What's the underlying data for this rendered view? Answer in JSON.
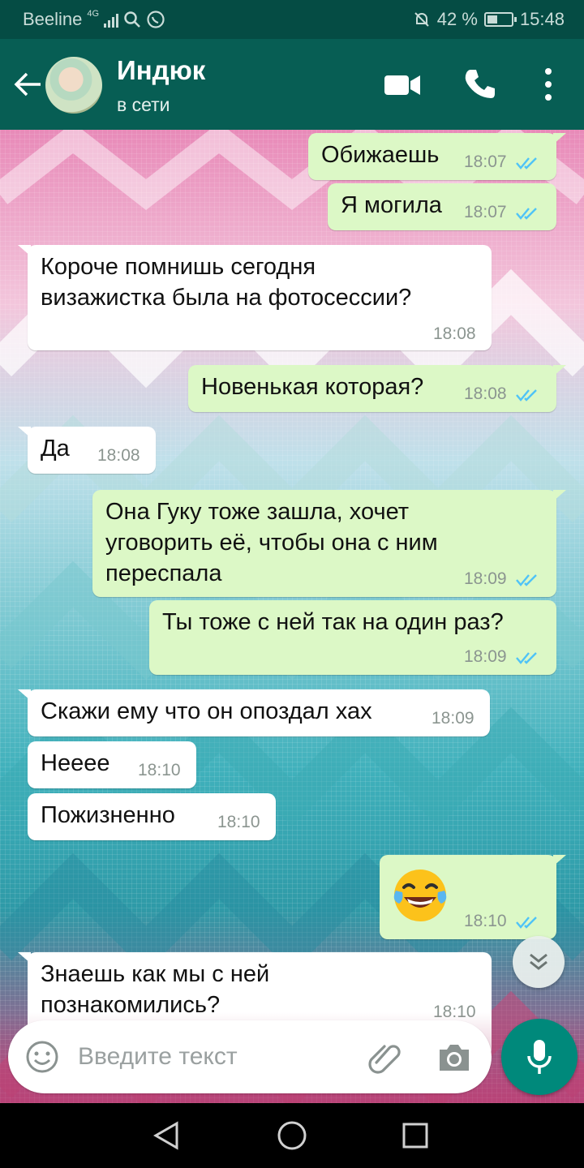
{
  "status_bar": {
    "carrier": "Beeline",
    "network": "4G",
    "battery": "42 %",
    "battery_level": 0.42,
    "time": "15:48",
    "icons": [
      "signal-icon",
      "search-icon",
      "whatsapp-icon",
      "mute-bell-icon",
      "battery-icon"
    ]
  },
  "header": {
    "contact_name": "Индюк",
    "contact_status": "в сети",
    "actions": [
      "video-call-icon",
      "voice-call-icon",
      "more-options-icon"
    ],
    "accent_color": "#075e54"
  },
  "messages": [
    {
      "direction": "out",
      "text": "Обижаешь",
      "time": "18:07",
      "read": true
    },
    {
      "direction": "out",
      "text": "Я могила",
      "time": "18:07",
      "read": true
    },
    {
      "direction": "in",
      "text": "Короче помнишь сегодня\nвизажистка была на фотосессии?",
      "time": "18:08"
    },
    {
      "direction": "out",
      "text": "Новенькая которая?",
      "time": "18:08",
      "read": true
    },
    {
      "direction": "in",
      "text": "Да",
      "time": "18:08"
    },
    {
      "direction": "out",
      "text": "Она Гуку тоже зашла, хочет\nуговорить её, чтобы она с ним\nпереспала",
      "time": "18:09",
      "read": true
    },
    {
      "direction": "out",
      "text": "Ты тоже с ней так на один раз?",
      "time": "18:09",
      "read": true
    },
    {
      "direction": "in",
      "text": "Скажи ему что он опоздал хах",
      "time": "18:09"
    },
    {
      "direction": "in",
      "text": "Нееее",
      "time": "18:10"
    },
    {
      "direction": "in",
      "text": "Пожизненно",
      "time": "18:10"
    },
    {
      "direction": "out",
      "emoji": "face-with-tears-of-joy",
      "time": "18:10",
      "read": true
    },
    {
      "direction": "in",
      "text": "Знаешь как мы с ней\nпознакомились?",
      "time": "18:10"
    }
  ],
  "composer": {
    "placeholder": "Введите текст",
    "icons": [
      "emoji-icon",
      "attach-icon",
      "camera-icon",
      "mic-icon"
    ]
  },
  "colors": {
    "outgoing_bubble": "#dcf8c6",
    "incoming_bubble": "#ffffff",
    "read_ticks": "#4fc3f7",
    "mic_button": "#00897b"
  }
}
